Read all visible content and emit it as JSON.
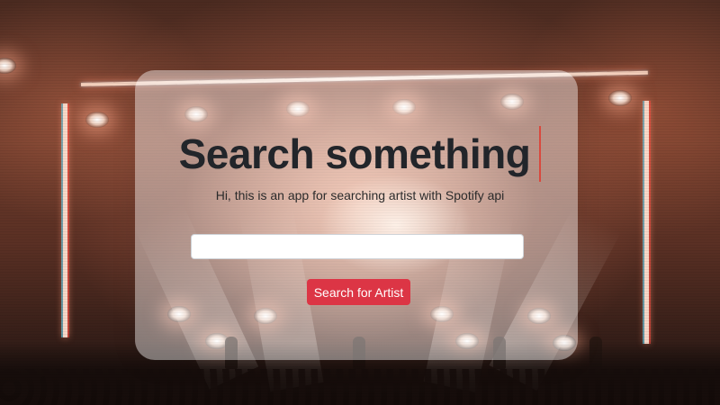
{
  "hero": {
    "title": "Search something",
    "subtitle": "Hi, this is an app for searching artist with Spotify api"
  },
  "search": {
    "input_value": "",
    "placeholder": "",
    "button_label": "Search for Artist"
  },
  "colors": {
    "button": "#dc3545",
    "cursor": "#d9493e",
    "title": "#22252a"
  }
}
